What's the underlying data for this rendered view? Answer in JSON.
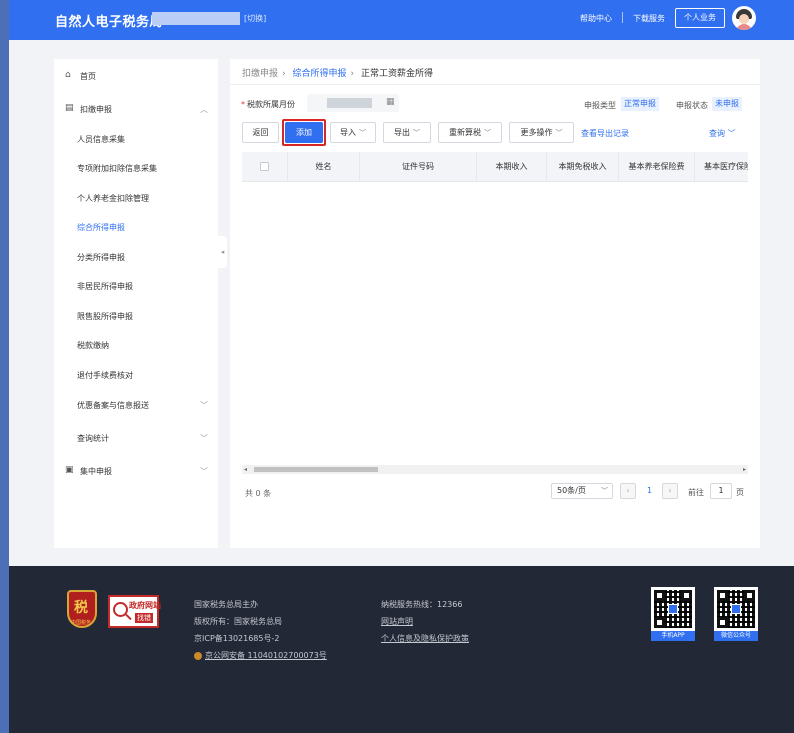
{
  "header": {
    "site_title": "自然人电子税务局",
    "switch_label": "[切换]",
    "help_center": "帮助中心",
    "download_service": "下载服务",
    "personal_business": "个人业务"
  },
  "sidebar": {
    "items": [
      {
        "label": "首页",
        "icon": "home-icon"
      },
      {
        "label": "扣缴申报",
        "icon": "document-icon",
        "expanded": true
      },
      {
        "label": "人员信息采集"
      },
      {
        "label": "专项附加扣除信息采集"
      },
      {
        "label": "个人养老金扣除管理"
      },
      {
        "label": "综合所得申报",
        "active": true
      },
      {
        "label": "分类所得申报"
      },
      {
        "label": "非居民所得申报"
      },
      {
        "label": "限售股所得申报"
      },
      {
        "label": "税款缴纳"
      },
      {
        "label": "退付手续费核对"
      },
      {
        "label": "优惠备案与信息报送"
      },
      {
        "label": "查询统计"
      },
      {
        "label": "集中申报",
        "icon": "collection-icon"
      }
    ]
  },
  "breadcrumb": [
    "扣缴申报",
    "综合所得申报",
    "正常工资薪金所得"
  ],
  "form": {
    "period_label": "税款所属月份",
    "required_mark": "*",
    "decl_type_label": "申报类型",
    "decl_type_value": "正常申报",
    "decl_status_label": "申报状态",
    "decl_status_value": "未申报"
  },
  "toolbar": {
    "back": "返回",
    "add": "添加",
    "import": "导入",
    "export": "导出",
    "recalc": "重新算税",
    "more": "更多操作",
    "export_log": "查看导出记录",
    "query": "查询"
  },
  "table": {
    "columns": [
      "姓名",
      "证件号码",
      "本期收入",
      "本期免税收入",
      "基本养老保险费",
      "基本医疗保险费"
    ],
    "rows": []
  },
  "pagination": {
    "total": "共 0 条",
    "page_size": "50条/页",
    "current_page": "1",
    "goto_label": "前往",
    "goto_value": "1",
    "page_suffix": "页"
  },
  "footer": {
    "emblem_caption": "中国税务",
    "gov_site_line1": "政府网站",
    "gov_site_line2": "找错",
    "host": "国家税务总局主办",
    "copyright": "版权所有：国家税务总局",
    "icp": "京ICP备13021685号-2",
    "police": "京公网安备 11040102700073号",
    "hotline": "纳税服务热线：12366",
    "site_statement": "网站声明",
    "privacy": "个人信息及隐私保护政策",
    "qr_app": "手机APP",
    "qr_wechat": "微信公众号"
  },
  "colors": {
    "primary": "#2f6ff0",
    "highlight_outline": "#d92626",
    "footer_bg": "#232836"
  }
}
